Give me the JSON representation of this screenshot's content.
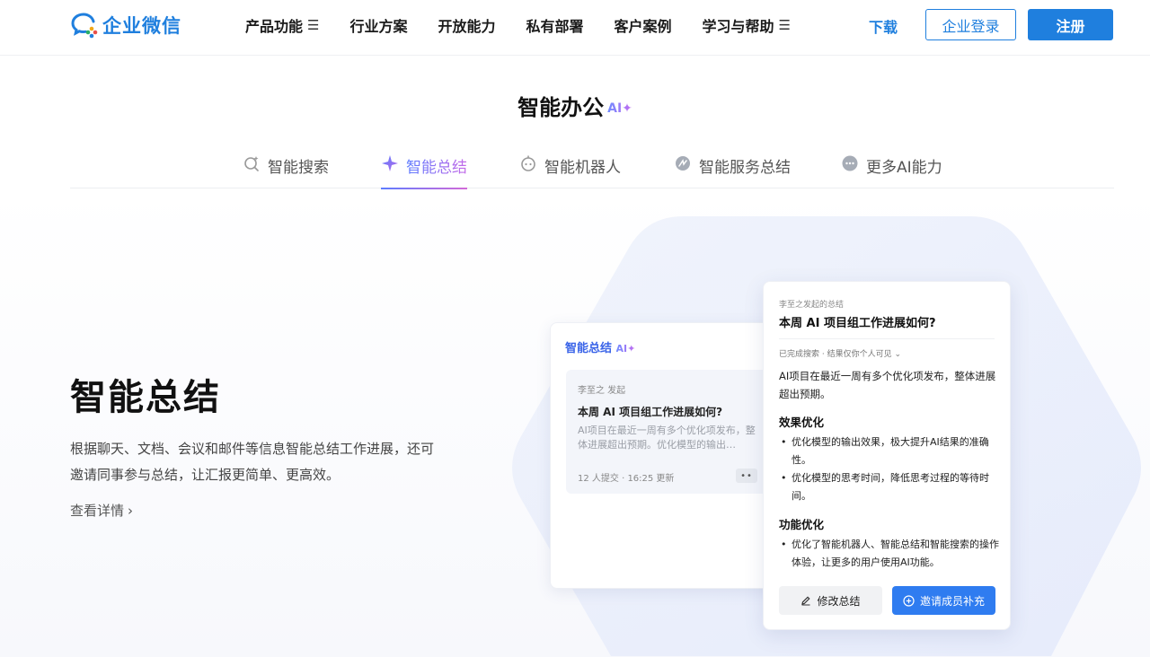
{
  "brand": {
    "name": "企业微信"
  },
  "nav": {
    "items": [
      {
        "label": "产品功能",
        "has_menu": true
      },
      {
        "label": "行业方案",
        "has_menu": false
      },
      {
        "label": "开放能力",
        "has_menu": false
      },
      {
        "label": "私有部署",
        "has_menu": false
      },
      {
        "label": "客户案例",
        "has_menu": false
      },
      {
        "label": "学习与帮助",
        "has_menu": true
      }
    ],
    "menu_glyph": "☰",
    "download_label": "下载",
    "login_label": "企业登录",
    "register_label": "注册"
  },
  "section": {
    "title": "智能办公",
    "ai_tag": "AI✦"
  },
  "tabs": [
    {
      "label": "智能搜索",
      "icon": "search-sparkle-icon",
      "active": false
    },
    {
      "label": "智能总结",
      "icon": "sparkle-icon",
      "active": true
    },
    {
      "label": "智能机器人",
      "icon": "robot-icon",
      "active": false
    },
    {
      "label": "智能服务总结",
      "icon": "service-icon",
      "active": false
    },
    {
      "label": "更多AI能力",
      "icon": "more-icon",
      "active": false
    }
  ],
  "feature": {
    "title": "智能总结",
    "description": "根据聊天、文档、会议和邮件等信息智能总结工作进展，还可邀请同事参与总结，让汇报更简单、更高效。",
    "link_label": "查看详情",
    "link_chevron": "›"
  },
  "card_summary": {
    "title": "智能总结",
    "ai_tag": "AI✦",
    "item": {
      "meta": "李至之 发起",
      "question": "本周 AI 项目组工作进展如何?",
      "preview": "AI项目在最近一周有多个优化项发布，整体进展超出预期。优化模型的输出…",
      "footer": "12 人提交 · 16:25 更新",
      "more": "••"
    }
  },
  "card_detail": {
    "meta": "李至之发起的总结",
    "title": "本周 AI 项目组工作进展如何?",
    "status": "已完成搜索 · 结果仅你个人可见 ⌄",
    "intro": "AI项目在最近一周有多个优化项发布，整体进展超出预期。",
    "sections": [
      {
        "heading": "效果优化",
        "bullets": [
          "优化模型的输出效果，极大提升AI结果的准确性。",
          "优化模型的思考时间，降低思考过程的等待时间。"
        ]
      },
      {
        "heading": "功能优化",
        "bullets": [
          "优化了智能机器人、智能总结和智能搜索的操作体验，让更多的用户使用AI功能。"
        ]
      }
    ],
    "edit_label": "修改总结",
    "invite_label": "邀请成员补充"
  },
  "colors": {
    "brand_blue": "#1f7fde",
    "accent_purple": "#7a5cf0",
    "button_blue": "#2f7cf0"
  }
}
